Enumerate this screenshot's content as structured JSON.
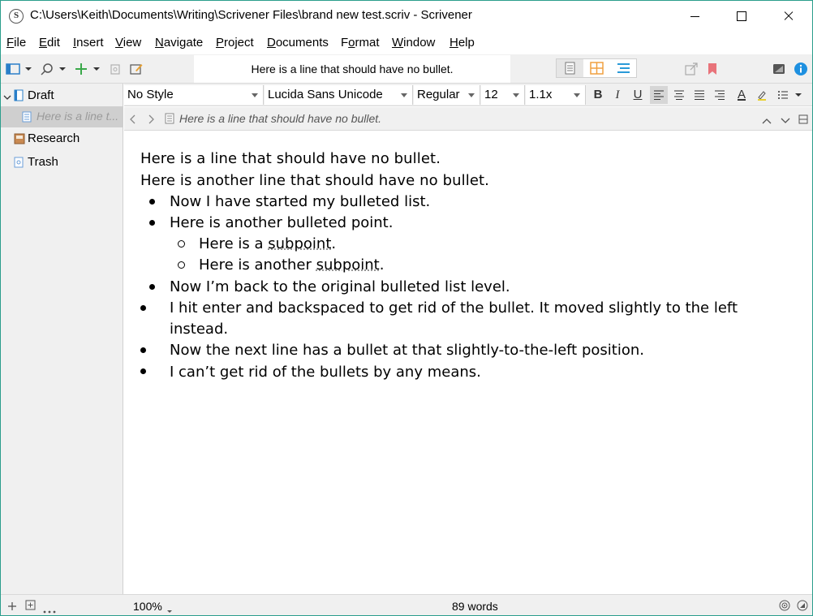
{
  "window": {
    "title": "C:\\Users\\Keith\\Documents\\Writing\\Scrivener Files\\brand new test.scriv - Scrivener",
    "logo_letter": "S"
  },
  "menu": [
    "File",
    "Edit",
    "Insert",
    "View",
    "Navigate",
    "Project",
    "Documents",
    "Format",
    "Window",
    "Help"
  ],
  "menu_underline": [
    "F",
    "E",
    "I",
    "V",
    "N",
    "P",
    "D",
    "o",
    "W",
    "H"
  ],
  "toolbar": {
    "document_title": "Here is a line that should have no bullet."
  },
  "binder": {
    "items": [
      {
        "label": "Draft",
        "type": "folder"
      },
      {
        "label": "Here is a line t...",
        "type": "document",
        "selected": true
      },
      {
        "label": "Research",
        "type": "folder"
      },
      {
        "label": "Trash",
        "type": "trash"
      }
    ]
  },
  "format_bar": {
    "style": "No Style",
    "font": "Lucida Sans Unicode",
    "weight": "Regular",
    "size": "12",
    "line_spacing": "1.1x",
    "bold": "B",
    "italic": "I",
    "underline": "U",
    "text_color_glyph": "A"
  },
  "header_bar": {
    "document_title": "Here is a line that should have no bullet."
  },
  "editor": {
    "lines": [
      {
        "text": "Here is a line that should have no bullet.",
        "bullet": "none"
      },
      {
        "text": "Here is another line that should have no bullet.",
        "bullet": "none"
      },
      {
        "text": "Now I have started my bulleted list.",
        "bullet": "disc"
      },
      {
        "text": "Here is another bulleted point.",
        "bullet": "disc"
      },
      {
        "text_before": "Here is a ",
        "text_underlined": "subpoint",
        "text_after": ".",
        "bullet": "circle"
      },
      {
        "text_before": "Here is another ",
        "text_underlined": "subpoint",
        "text_after": ".",
        "bullet": "circle"
      },
      {
        "text": "Now I’m back to the original bulleted list level.",
        "bullet": "disc"
      },
      {
        "text": "I hit enter and backspaced to get rid of the bullet. It moved slightly to the left",
        "continuation": "instead.",
        "bullet": "disc-left"
      },
      {
        "text": "Now the next line has a bullet at that slightly-to-the-left position.",
        "bullet": "disc-left"
      },
      {
        "text": "I can’t get rid of the bullets by any means.",
        "bullet": "disc-left"
      }
    ]
  },
  "status_bar": {
    "zoom": "100%",
    "word_count": "89 words"
  },
  "colors": {
    "window_border": "#2b9e8c",
    "add_green": "#3aa84a",
    "bookmark_red": "#e8737a",
    "info_blue": "#1e90e0",
    "view_orange": "#f0a040",
    "view_blue": "#2a9ad8"
  }
}
